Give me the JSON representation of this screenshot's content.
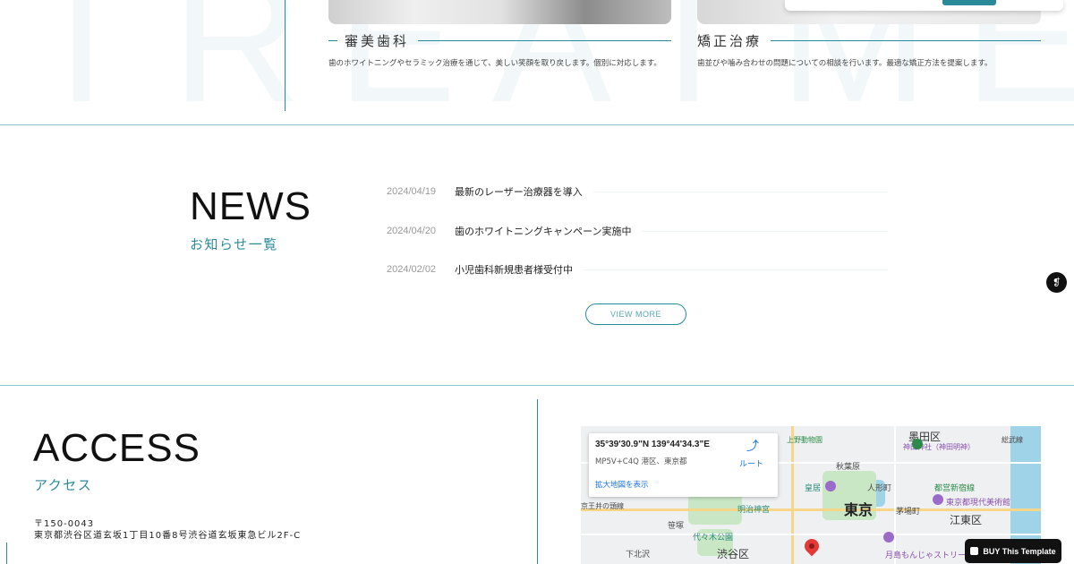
{
  "treatment": {
    "watermark": "TREATMENT",
    "cards": [
      {
        "title": "審美歯科",
        "desc": "歯のホワイトニングやセラミック治療を通じて、美しい笑顔を取り戻します。個別に対応します。"
      },
      {
        "title": "矯正治療",
        "desc": "歯並びや噛み合わせの問題についての相談を行います。最適な矯正方法を提案します。"
      }
    ]
  },
  "news": {
    "title": "NEWS",
    "subtitle": "お知らせ一覧",
    "items": [
      {
        "date": "2024/04/19",
        "title": "最新のレーザー治療器を導入"
      },
      {
        "date": "2024/04/20",
        "title": "歯のホワイトニングキャンペーン実施中"
      },
      {
        "date": "2024/02/02",
        "title": "小児歯科新規患者様受付中"
      }
    ],
    "view_more": "VIEW MORE"
  },
  "access": {
    "title": "ACCESS",
    "subtitle": "アクセス",
    "postal": "〒150-0043",
    "address": "東京都渋谷区道玄坂1丁目10番8号渋谷道玄坂東急ビル2F-C"
  },
  "map": {
    "coords": "35°39'30.9\"N 139°44'34.3\"E",
    "plus_code": "MP5V+C4Q 港区、東京都",
    "enlarge_link": "拡大地図を表示",
    "directions_label": "ルート",
    "labels": {
      "sumida": "墨田区",
      "kanda": "神田神社（神田明神）",
      "akihabara": "秋葉原",
      "imperial": "皇居",
      "ningyocho": "人形町",
      "tokyo": "東京",
      "meiji": "明治神宮",
      "kayabacho": "茅場町",
      "tosei": "都営新宿線",
      "mot": "東京都現代美術館",
      "koto": "江東区",
      "sasazuka": "笹塚",
      "yoyogi": "代々木公園",
      "shimokita": "下北沢",
      "shibuya": "渋谷区",
      "tsukishima": "月島もんじゃストリート",
      "ueno": "上野動物園",
      "kyokoen": "京王井の頭線",
      "sobu": "総武線"
    }
  },
  "buy_button": "BUY This Template",
  "colors": {
    "accent": "#2b8a9a",
    "rule": "#8ec6cf"
  }
}
